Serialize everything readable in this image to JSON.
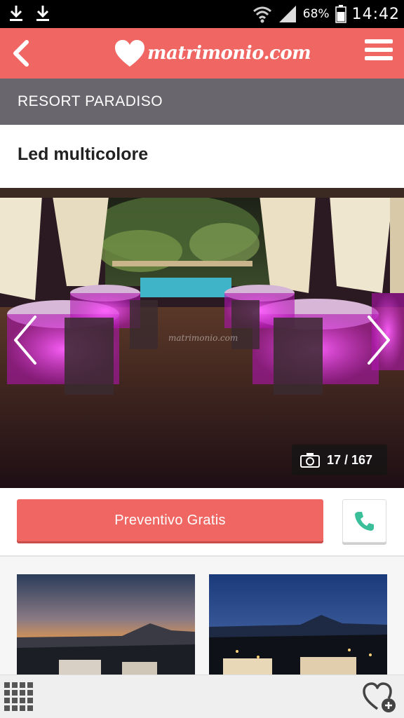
{
  "status_bar": {
    "battery_percent": "68%",
    "time": "14:42",
    "icons": [
      "download-icon",
      "download-icon",
      "wifi-icon",
      "signal-icon",
      "battery-icon"
    ]
  },
  "header": {
    "logo_text": "matrimonio.com",
    "icons": [
      "back-arrow-icon",
      "heart-logo-icon",
      "hamburger-menu-icon"
    ],
    "brand_color": "#ef6662"
  },
  "venue": {
    "name": "RESORT PARADISO"
  },
  "photo": {
    "title": "Led multicolore",
    "watermark": "matrimonio.com",
    "counter": "17 / 167",
    "icons": [
      "chevron-left-icon",
      "chevron-right-icon",
      "camera-icon"
    ]
  },
  "actions": {
    "quote_label": "Preventivo Gratis",
    "call_icon": "phone-icon",
    "phone_color": "#3bbf9b"
  },
  "bottom_bar": {
    "icons": [
      "grid-menu-icon",
      "heart-plus-icon"
    ]
  }
}
